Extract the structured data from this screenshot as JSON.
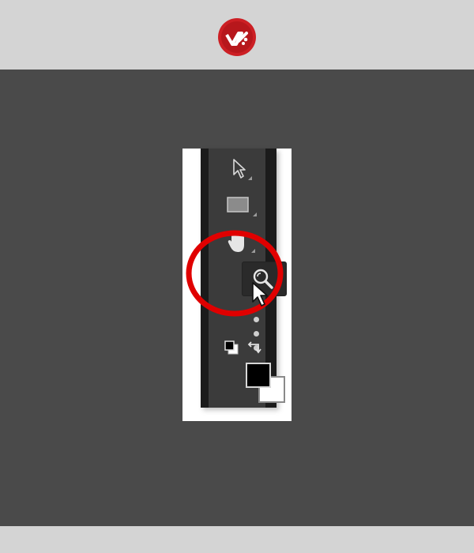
{
  "header": {
    "logo_icon": "brand-logo-icon",
    "brand_color": "#cc1f24"
  },
  "toolbar": {
    "tools": [
      {
        "name": "move",
        "icon": "cursor-arrow-icon"
      },
      {
        "name": "rectangle",
        "icon": "rectangle-icon"
      },
      {
        "name": "hand",
        "icon": "hand-icon"
      },
      {
        "name": "zoom",
        "icon": "magnifier-icon",
        "active": true
      },
      {
        "name": "more",
        "icon": "more-icon"
      },
      {
        "name": "default-colors",
        "icon": "default-colors-icon"
      },
      {
        "name": "swap-colors",
        "icon": "swap-colors-icon"
      }
    ],
    "foreground_color": "#000000",
    "background_color": "#ffffff"
  },
  "annotation": {
    "highlight_color": "#e00000"
  }
}
